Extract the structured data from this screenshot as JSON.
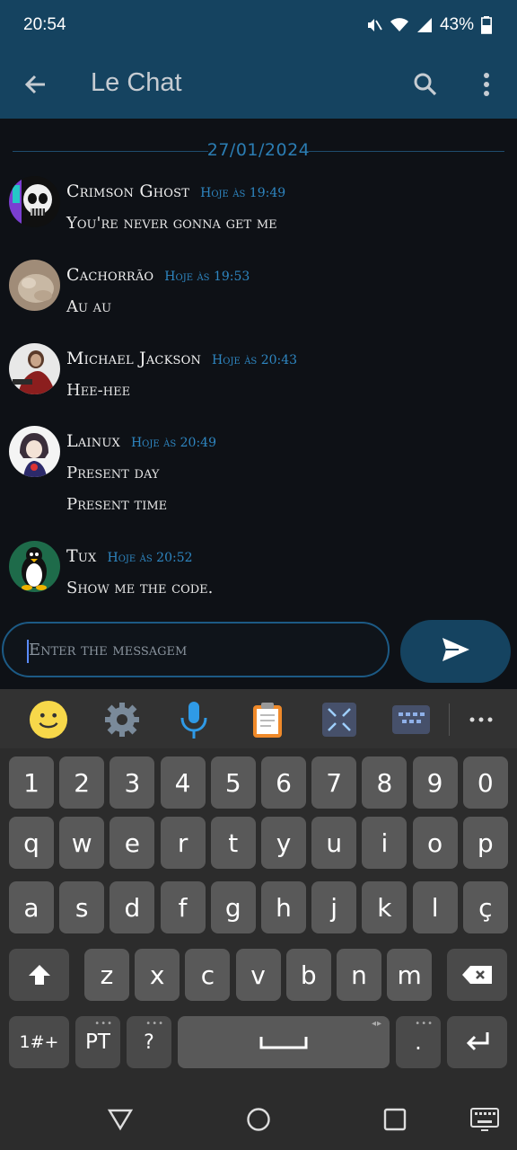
{
  "status": {
    "time": "20:54",
    "battery": "43%",
    "icons": [
      "mute-icon",
      "wifi-icon",
      "signal-icon",
      "battery-icon"
    ]
  },
  "appbar": {
    "title": "Le Chat",
    "icons": [
      "back-arrow-icon",
      "search-icon",
      "more-vert-icon"
    ]
  },
  "chat": {
    "date": "27/01/2024",
    "messages": [
      {
        "name": "Crimson Ghost",
        "time": "Hoje às 19:49",
        "lines": [
          "You're never gonna get me"
        ]
      },
      {
        "name": "Cachorrão",
        "time": "Hoje às 19:53",
        "lines": [
          "Au au"
        ]
      },
      {
        "name": "Michael Jackson",
        "time": "Hoje às 20:43",
        "lines": [
          "Hee-hee"
        ]
      },
      {
        "name": "Lainux",
        "time": "Hoje às 20:49",
        "lines": [
          "Present day",
          "Present time"
        ]
      },
      {
        "name": "Tux",
        "time": "Hoje às 20:52",
        "lines": [
          "Show me the code."
        ]
      }
    ]
  },
  "composer": {
    "placeholder": "Enter the messagem",
    "send_icon": "send-icon"
  },
  "keyboard": {
    "toolbar": [
      "emoji-icon",
      "settings-icon",
      "mic-icon",
      "clipboard-icon",
      "resize-icon",
      "keyboard-layout-icon",
      "more-icon"
    ],
    "row_numbers": [
      "1",
      "2",
      "3",
      "4",
      "5",
      "6",
      "7",
      "8",
      "9",
      "0"
    ],
    "row1": [
      "q",
      "w",
      "e",
      "r",
      "t",
      "y",
      "u",
      "i",
      "o",
      "p"
    ],
    "row2": [
      "a",
      "s",
      "d",
      "f",
      "g",
      "h",
      "j",
      "k",
      "l",
      "ç"
    ],
    "row3": [
      "z",
      "x",
      "c",
      "v",
      "b",
      "n",
      "m"
    ],
    "symbols_key": "1#+",
    "lang_key": "PT",
    "question_key": "?",
    "period_key": "."
  },
  "navbar": {
    "icons": [
      "back-triangle-icon",
      "home-circle-icon",
      "recents-square-icon",
      "keyboard-switch-icon"
    ]
  },
  "colors": {
    "header": "#154360",
    "background": "#0e1116",
    "accent": "#2e86c1"
  }
}
